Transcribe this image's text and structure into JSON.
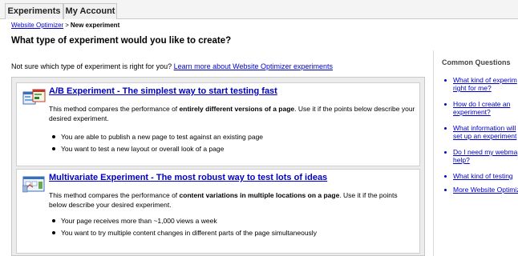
{
  "nav": {
    "tabs": [
      {
        "label": "Experiments"
      },
      {
        "label": "My Account"
      }
    ]
  },
  "breadcrumb": {
    "home": "Website Optimizer",
    "separator": ">",
    "current": "New experiment"
  },
  "page_title": "What type of experiment would you like to create?",
  "intro": {
    "text": "Not sure which type of experiment is right for you?",
    "link": "Learn more about Website Optimizer experiments"
  },
  "options": [
    {
      "title": "A/B Experiment - The simplest way to start testing fast",
      "desc_before": "This method compares the performance of ",
      "desc_bold": "entirely different versions of a page",
      "desc_after": ". Use it if the points below describe your desired experiment.",
      "bullets": [
        "You are able to publish a new page to test against an existing page",
        "You want to test a new layout or overall look of a page"
      ]
    },
    {
      "title": "Multivariate Experiment - The most robust way to test lots of ideas",
      "desc_before": "This method compares the performance of ",
      "desc_bold": "content variations in multiple locations on a page",
      "desc_after": ". Use it if the points below describe your desired experiment.",
      "bullets": [
        "Your page receives more than ~1,000 views a week",
        "You want to try multiple content changes in different parts of the page simultaneously"
      ]
    }
  ],
  "sidebar": {
    "title": "Common Questions",
    "questions": [
      {
        "line1": "What kind of experim",
        "line2": "right for me?"
      },
      {
        "line1": "How do I create an",
        "line2": "experiment?"
      },
      {
        "line1": "What information will",
        "line2": "set up an experiment"
      },
      {
        "line1": "Do I need my webma",
        "line2": "help?"
      },
      {
        "line1": "What kind of testing",
        "line2": ""
      },
      {
        "line1": "More Website Optimiz",
        "line2": ""
      }
    ]
  }
}
